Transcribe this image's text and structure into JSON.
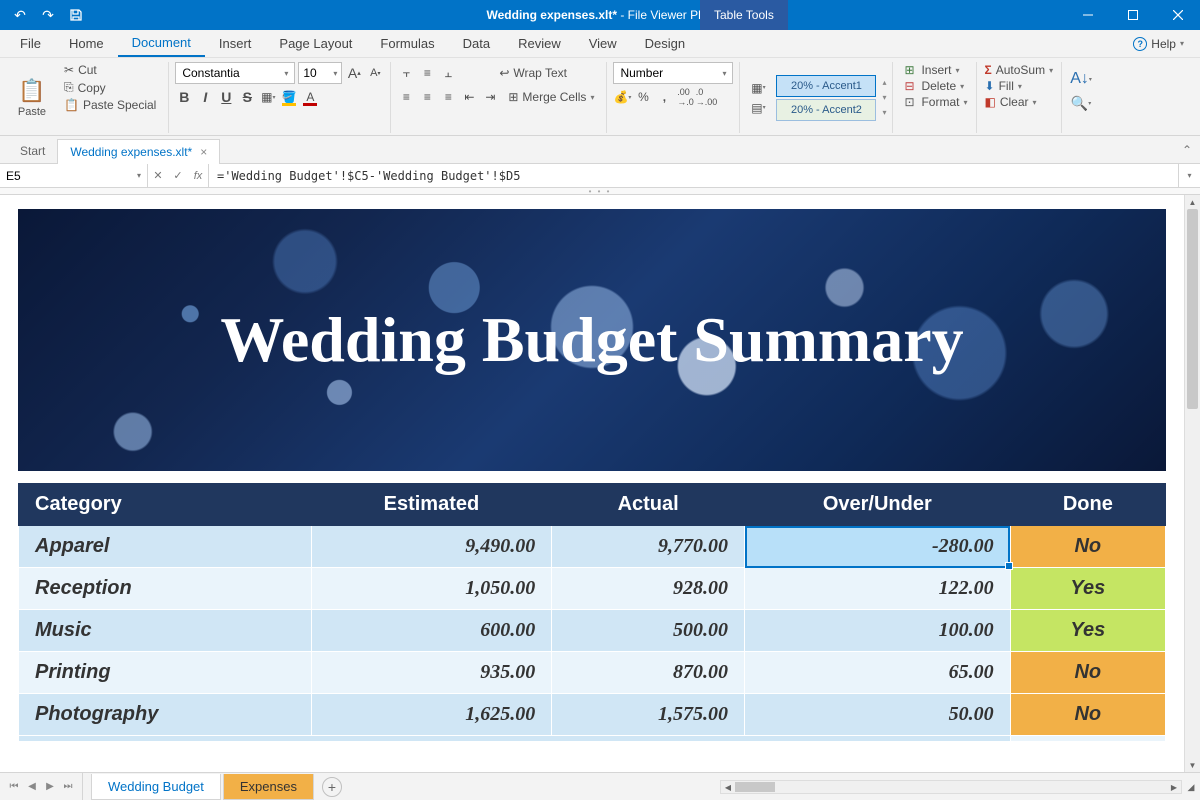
{
  "titlebar": {
    "title_filename": "Wedding expenses.xlt*",
    "title_suffix": " - File Viewer Plus",
    "table_tools": "Table Tools"
  },
  "menu": [
    "File",
    "Home",
    "Document",
    "Insert",
    "Page Layout",
    "Formulas",
    "Data",
    "Review",
    "View",
    "Design"
  ],
  "menu_active_index": 2,
  "help_label": "Help",
  "ribbon": {
    "paste_label": "Paste",
    "cut_label": "Cut",
    "copy_label": "Copy",
    "paste_special_label": "Paste Special",
    "font_name": "Constantia",
    "font_size": "10",
    "wrap_text_label": "Wrap Text",
    "merge_cells_label": "Merge Cells",
    "number_format": "Number",
    "accent1_label": "20% - Accent1",
    "accent2_label": "20% - Accent2",
    "cells_insert": "Insert",
    "cells_delete": "Delete",
    "cells_format": "Format",
    "autosum_label": "AutoSum",
    "fill_label": "Fill",
    "clear_label": "Clear"
  },
  "editor_tabs": {
    "start": "Start",
    "active": "Wedding expenses.xlt*"
  },
  "formula": {
    "cell_ref": "E5",
    "value": "='Wedding Budget'!$C5-'Wedding Budget'!$D5"
  },
  "banner_title": "Wedding Budget Summary",
  "table": {
    "headers": [
      "Category",
      "Estimated",
      "Actual",
      "Over/Under",
      "Done"
    ],
    "rows": [
      {
        "category": "Apparel",
        "estimated": "9,490.00",
        "actual": "9,770.00",
        "over_under": "-280.00",
        "done": "No",
        "selected": true
      },
      {
        "category": "Reception",
        "estimated": "1,050.00",
        "actual": "928.00",
        "over_under": "122.00",
        "done": "Yes"
      },
      {
        "category": "Music",
        "estimated": "600.00",
        "actual": "500.00",
        "over_under": "100.00",
        "done": "Yes"
      },
      {
        "category": "Printing",
        "estimated": "935.00",
        "actual": "870.00",
        "over_under": "65.00",
        "done": "No"
      },
      {
        "category": "Photography",
        "estimated": "1,625.00",
        "actual": "1,575.00",
        "over_under": "50.00",
        "done": "No"
      }
    ]
  },
  "sheets": {
    "tabs": [
      "Wedding Budget",
      "Expenses"
    ],
    "active_index": 1
  }
}
